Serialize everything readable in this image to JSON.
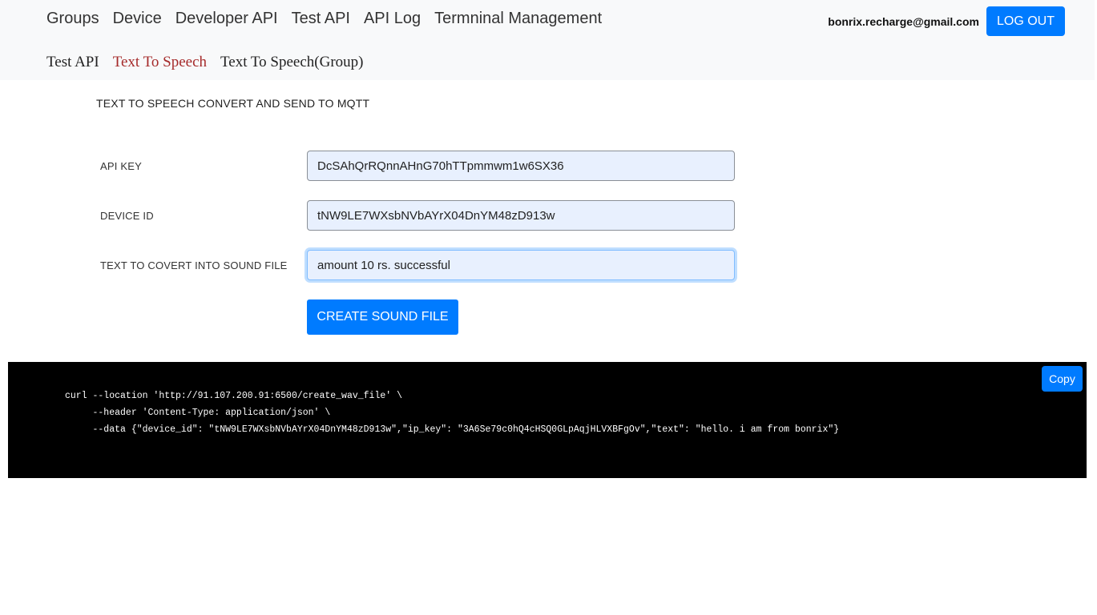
{
  "nav": {
    "items": [
      "Groups",
      "Device",
      "Developer API",
      "Test API",
      "API Log",
      "Termninal Management"
    ],
    "user_email": "bonrix.recharge@gmail.com",
    "logout_label": "LOG OUT"
  },
  "subnav": {
    "items": [
      "Test API",
      "Text To Speech",
      "Text To Speech(Group)"
    ],
    "active": "Text To Speech"
  },
  "page": {
    "title": "TEXT TO SPEECH CONVERT AND SEND TO MQTT"
  },
  "form": {
    "api_key_label": "API KEY",
    "api_key_value": "DcSAhQrRQnnAHnG70hTTpmmwm1w6SX36",
    "device_id_label": "DEVICE ID",
    "device_id_value": "tNW9LE7WXsbNVbAYrX04DnYM48zD913w",
    "text_label": "TEXT TO COVERT INTO SOUND FILE",
    "text_value": "amount 10 rs. successful",
    "submit_label": "CREATE SOUND FILE"
  },
  "code": {
    "copy_label": "Copy",
    "line1": "curl --location 'http://91.107.200.91:6500/create_wav_file' \\",
    "line2": "     --header 'Content-Type: application/json' \\",
    "line3": "     --data {\"device_id\": \"tNW9LE7WXsbNVbAYrX04DnYM48zD913w\",\"ip_key\": \"3A6Se79c0hQ4cHSQ0GLpAqjHLVXBFgOv\",\"text\": \"hello. i am from bonrix\"}"
  },
  "colors": {
    "primary": "#007bff",
    "active_subnav": "#a52a2a",
    "code_bg": "#000000",
    "input_bg": "#e8f0fe"
  }
}
